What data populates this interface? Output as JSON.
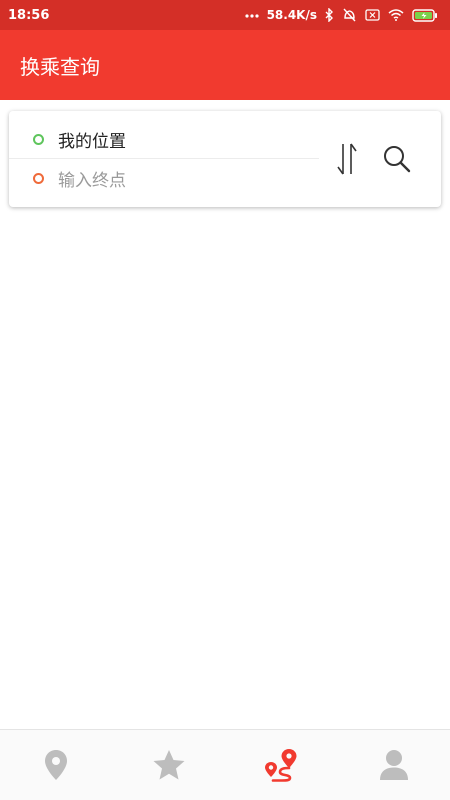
{
  "status_bar": {
    "time": "18:56",
    "net_speed": "58.4K/s",
    "icons": [
      "dots-icon",
      "bluetooth-icon",
      "mute-icon",
      "sim-icon",
      "wifi-icon",
      "battery-charging-icon"
    ]
  },
  "app_bar": {
    "title": "换乘查询"
  },
  "route_card": {
    "start_label": "我的位置",
    "end_placeholder": "输入终点",
    "swap_icon": "swap-vertical-icon",
    "search_icon": "search-icon"
  },
  "bottom_nav": {
    "items": [
      {
        "icon": "location-pin-icon",
        "active": false
      },
      {
        "icon": "star-icon",
        "active": false
      },
      {
        "icon": "route-icon",
        "active": true
      },
      {
        "icon": "person-icon",
        "active": false
      }
    ]
  },
  "colors": {
    "status_bar": "#d42f27",
    "app_bar": "#f13a2f",
    "start_dot": "#5ec55c",
    "end_dot": "#ef6a3a",
    "active_nav": "#f13a2f",
    "inactive_nav": "#bdbdbd"
  }
}
